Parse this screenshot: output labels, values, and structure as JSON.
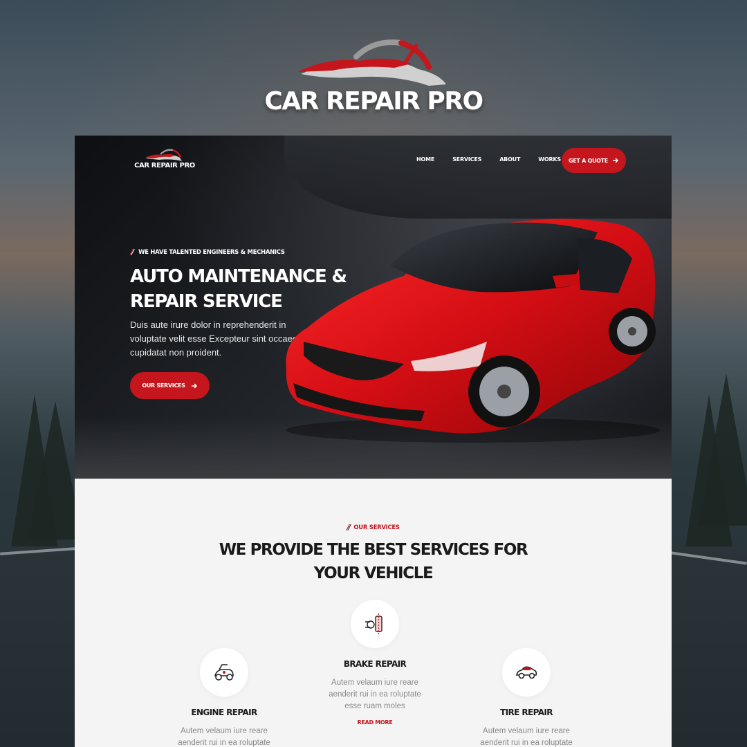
{
  "brand": {
    "name": "CAR REPAIR PRO"
  },
  "nav": {
    "logo_text": "CAR REPAIR PRO",
    "links": [
      "HOME",
      "SERVICES",
      "ABOUT",
      "WORKS"
    ],
    "cta": "GET A QUOTE"
  },
  "hero": {
    "kicker": "WE HAVE TALENTED ENGINEERS & MECHANICS",
    "title": "AUTO MAINTENANCE & REPAIR SERVICE",
    "description": "Duis aute irure dolor in reprehenderit in voluptate velit esse Excepteur sint occaecat cupidatat non proident.",
    "cta": "OUR SERVICES"
  },
  "services": {
    "kicker": "OUR SERVICES",
    "title": "WE PROVIDE THE BEST SERVICES FOR YOUR VEHICLE",
    "cards": [
      {
        "name": "ENGINE REPAIR",
        "icon": "engine-icon",
        "desc_line1": "Autem velaum iure reare",
        "desc_line2": "aenderit rui in ea roluptate"
      },
      {
        "name": "BRAKE REPAIR",
        "icon": "brake-icon",
        "desc": "Autem velaum iure reare aenderit rui in ea roluptate esse ruam moles",
        "more": "READ MORE"
      },
      {
        "name": "TIRE REPAIR",
        "icon": "tire-car-icon",
        "desc_line1": "Autem velaum iure reare",
        "desc_line2": "aenderit rui in ea roluptate"
      }
    ]
  },
  "colors": {
    "accent": "#c4161c",
    "hero_bg": "#15171a",
    "section_bg": "#f4f4f4"
  }
}
